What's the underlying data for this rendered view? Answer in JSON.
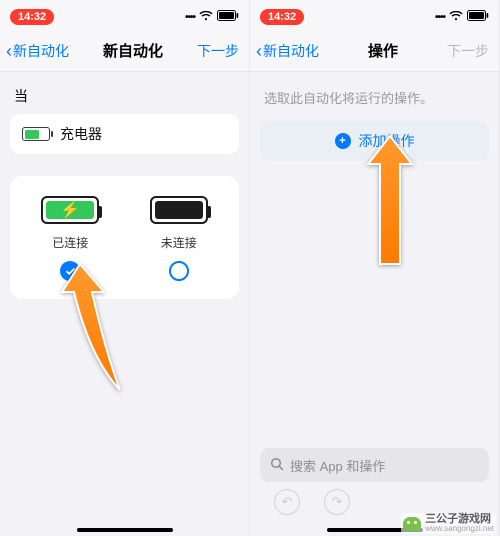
{
  "status": {
    "time": "14:32"
  },
  "left": {
    "nav": {
      "back": "新自动化",
      "title": "新自动化",
      "next": "下一步"
    },
    "when_label": "当",
    "charger_label": "充电器",
    "choices": {
      "connected": {
        "label": "已连接",
        "selected": true
      },
      "disconnected": {
        "label": "未连接",
        "selected": false
      }
    }
  },
  "right": {
    "nav": {
      "back": "新自动化",
      "title": "操作",
      "next": "下一步"
    },
    "hint": "选取此自动化将运行的操作。",
    "add_action": "添加操作",
    "search_placeholder": "搜索 App 和操作"
  },
  "watermark": {
    "cn": "三公子游戏网",
    "url": "www.sangongzi.net"
  }
}
